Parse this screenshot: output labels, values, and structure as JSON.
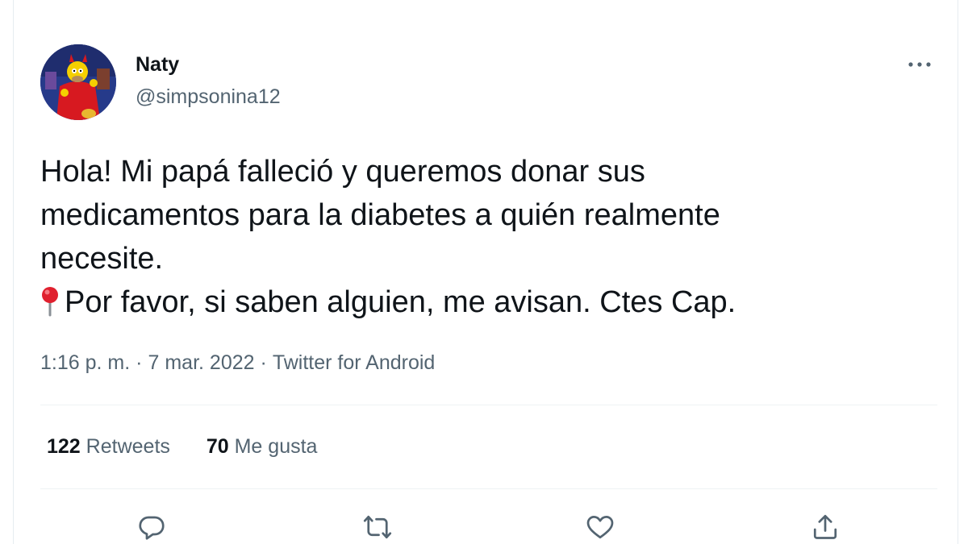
{
  "tweet": {
    "author": {
      "display_name": "Naty",
      "handle": "@simpsonina12",
      "avatar_icon": "homer-devil-avatar"
    },
    "text_lines": [
      "Hola! Mi papá falleció y queremos donar sus",
      "medicamentos para la diabetes a quién realmente",
      "necesite.",
      "Por favor, si saben alguien, me avisan. Ctes Cap."
    ],
    "pin_icon": "round-pushpin-emoji",
    "meta": {
      "time": "1:16 p. m.",
      "separator": "·",
      "date": "7 mar. 2022",
      "source": "Twitter for Android"
    },
    "stats": {
      "retweets_count": "122",
      "retweets_label": "Retweets",
      "likes_count": "70",
      "likes_label": "Me gusta"
    },
    "actions": [
      "reply-icon",
      "retweet-icon",
      "like-icon",
      "share-icon"
    ],
    "more_icon": "more-options-icon"
  },
  "colors": {
    "text_primary": "#0f1419",
    "text_secondary": "#536471",
    "divider": "#eff3f4",
    "pin_red": "#e0202e"
  }
}
